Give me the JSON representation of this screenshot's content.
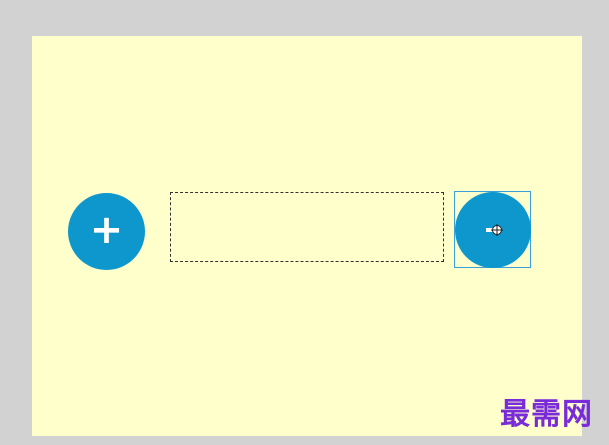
{
  "canvas": {
    "background_color": "#ffffcc",
    "frame_color": "#d2d2d2"
  },
  "buttons": {
    "plus": {
      "label": "+",
      "color": "#0e97cc",
      "icon": "plus-icon"
    },
    "minus": {
      "label": "-",
      "color": "#0e97cc",
      "icon": "minus-icon",
      "selected": true
    }
  },
  "text_box": {
    "value": ""
  },
  "cursor": {
    "icon": "crosshair-move-cursor-icon"
  },
  "watermark": {
    "text": "最需网",
    "color": "#7a2bd9"
  }
}
